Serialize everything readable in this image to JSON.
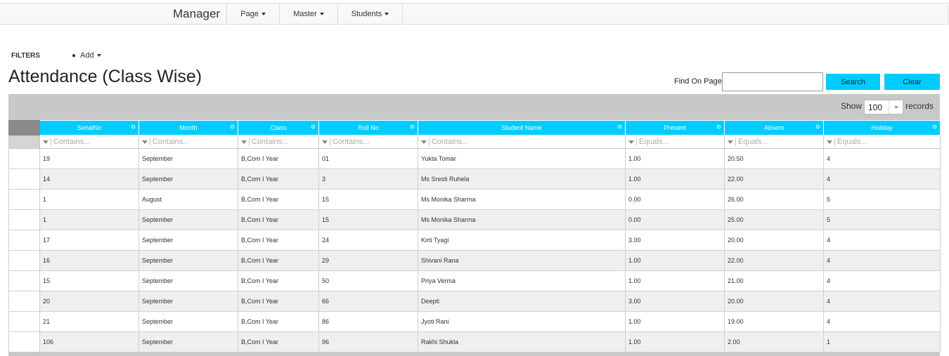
{
  "nav": {
    "brand": "Manager",
    "items": [
      {
        "label": "Page"
      },
      {
        "label": "Master"
      },
      {
        "label": "Students"
      }
    ]
  },
  "filters": {
    "label": "FILTERS",
    "add_label": "Add"
  },
  "page_title": "Attendance (Class Wise)",
  "find": {
    "label": "Find On Page",
    "value": "",
    "search_label": "Search",
    "clear_label": "Clear"
  },
  "paging": {
    "show_label": "Show",
    "page_size": "100",
    "records_label": "records"
  },
  "table": {
    "columns": [
      {
        "label": "SerialNo",
        "filter_placeholder": "Contains..."
      },
      {
        "label": "Month",
        "filter_placeholder": "Contains..."
      },
      {
        "label": "Class",
        "filter_placeholder": "Contains..."
      },
      {
        "label": "Roll No",
        "filter_placeholder": "Contains..."
      },
      {
        "label": "Student Name",
        "filter_placeholder": "Contains..."
      },
      {
        "label": "Present",
        "filter_placeholder": "Equals..."
      },
      {
        "label": "Absent",
        "filter_placeholder": "Equals..."
      },
      {
        "label": "Holiday",
        "filter_placeholder": "Equals..."
      }
    ],
    "rows": [
      [
        "19",
        "September",
        "B,Com I Year",
        "01",
        "Yukta Tomar",
        "1.00",
        "20.50",
        "4"
      ],
      [
        "14",
        "September",
        "B,Com I Year",
        "3",
        "Ms Sresti Ruhela",
        "1.00",
        "22.00",
        "4"
      ],
      [
        "1",
        "August",
        "B,Com I Year",
        "15",
        "Ms Monika Sharma",
        "0.00",
        "26.00",
        "5"
      ],
      [
        "1",
        "September",
        "B,Com I Year",
        "15",
        "Ms Monika Sharma",
        "0.00",
        "25.00",
        "5"
      ],
      [
        "17",
        "September",
        "B,Com I Year",
        "24",
        "Kirti Tyagi",
        "3.00",
        "20.00",
        "4"
      ],
      [
        "16",
        "September",
        "B,Com I Year",
        "29",
        "Shivani Rana",
        "1.00",
        "22.00",
        "4"
      ],
      [
        "15",
        "September",
        "B,Com I Year",
        "50",
        "Priya Verma",
        "1.00",
        "21.00",
        "4"
      ],
      [
        "20",
        "September",
        "B,Com I Year",
        "66",
        "Deepti",
        "3.00",
        "20.00",
        "4"
      ],
      [
        "21",
        "September",
        "B,Com I Year",
        "86",
        "Jyoti Rani",
        "1.00",
        "19.00",
        "4"
      ],
      [
        "106",
        "September",
        "B,Com I Year",
        "96",
        "Rakhi Shukla",
        "1.00",
        "2.00",
        "1"
      ]
    ]
  }
}
